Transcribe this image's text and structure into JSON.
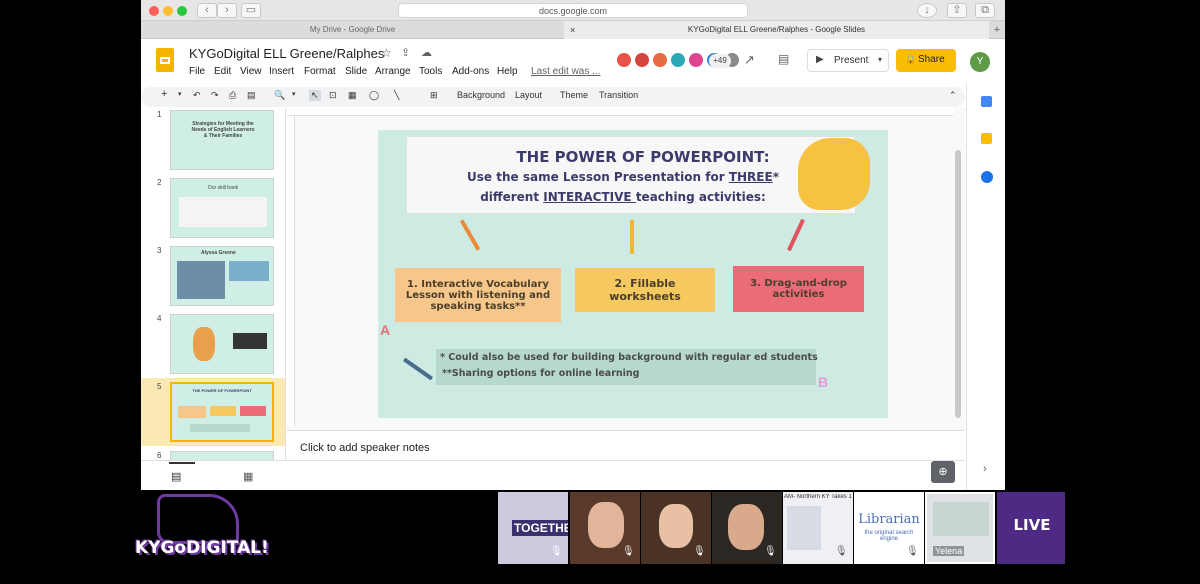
{
  "browser": {
    "url": "docs.google.com",
    "tabs": [
      "My Drive - Google Drive",
      "KYGoDigital ELL Greene/Ralphes - Google Slides"
    ]
  },
  "app": {
    "doc_title": "KYGoDigital ELL Greene/Ralphes",
    "menus": [
      "File",
      "Edit",
      "View",
      "Insert",
      "Format",
      "Slide",
      "Arrange",
      "Tools",
      "Add-ons",
      "Help"
    ],
    "last_edit": "Last edit was ...",
    "avatar_count": "+49",
    "present_label": "Present",
    "share_label": "Share",
    "user_initial": "Y"
  },
  "toolbar": {
    "background": "Background",
    "layout": "Layout",
    "theme": "Theme",
    "transition": "Transition"
  },
  "filmstrip": {
    "numbers": [
      "1",
      "2",
      "3",
      "4",
      "5",
      "6"
    ],
    "slide1_title": "Strategies for Meeting the Needs of English Learners & Their Families",
    "slide2_title": "Our skill bank",
    "slide3_title": "Alyssa Greene",
    "slide5_title": "THE POWER OF POWERPOINT"
  },
  "slide": {
    "title": "THE POWER OF POWERPOINT:",
    "line2_pre": "Use the same Lesson Presentation for ",
    "line2_link": "THREE",
    "line2_post": "*",
    "line3_pre": "different ",
    "line3_link": "INTERACTIVE ",
    "line3_post": " teaching activities:",
    "box1": "1. Interactive Vocabulary Lesson with listening and speaking tasks**",
    "box2": "2. Fillable worksheets",
    "box3": "3. Drag-and-drop activities",
    "note1": "* Could also be used for building background with regular ed students",
    "note2": "**Sharing options for online learning",
    "letter_a": "A",
    "letter_b": "B"
  },
  "notes": {
    "placeholder": "Click to add speaker notes"
  },
  "stream": {
    "logo": "KYGoDIGITAL!",
    "participant": "Yelena",
    "live": "LIVE",
    "librarian": "Librarian",
    "librarian_sub": "the original search engine",
    "banner": "AM- Northern KY Takes 1",
    "together": "TOGETHER"
  },
  "colors": {
    "slide_bg": "#cdebe2",
    "box1": "#f7c68a",
    "box2": "#f6c860",
    "box3": "#ec6b78",
    "share": "#fbbc04",
    "title": "#3b3b6b"
  }
}
